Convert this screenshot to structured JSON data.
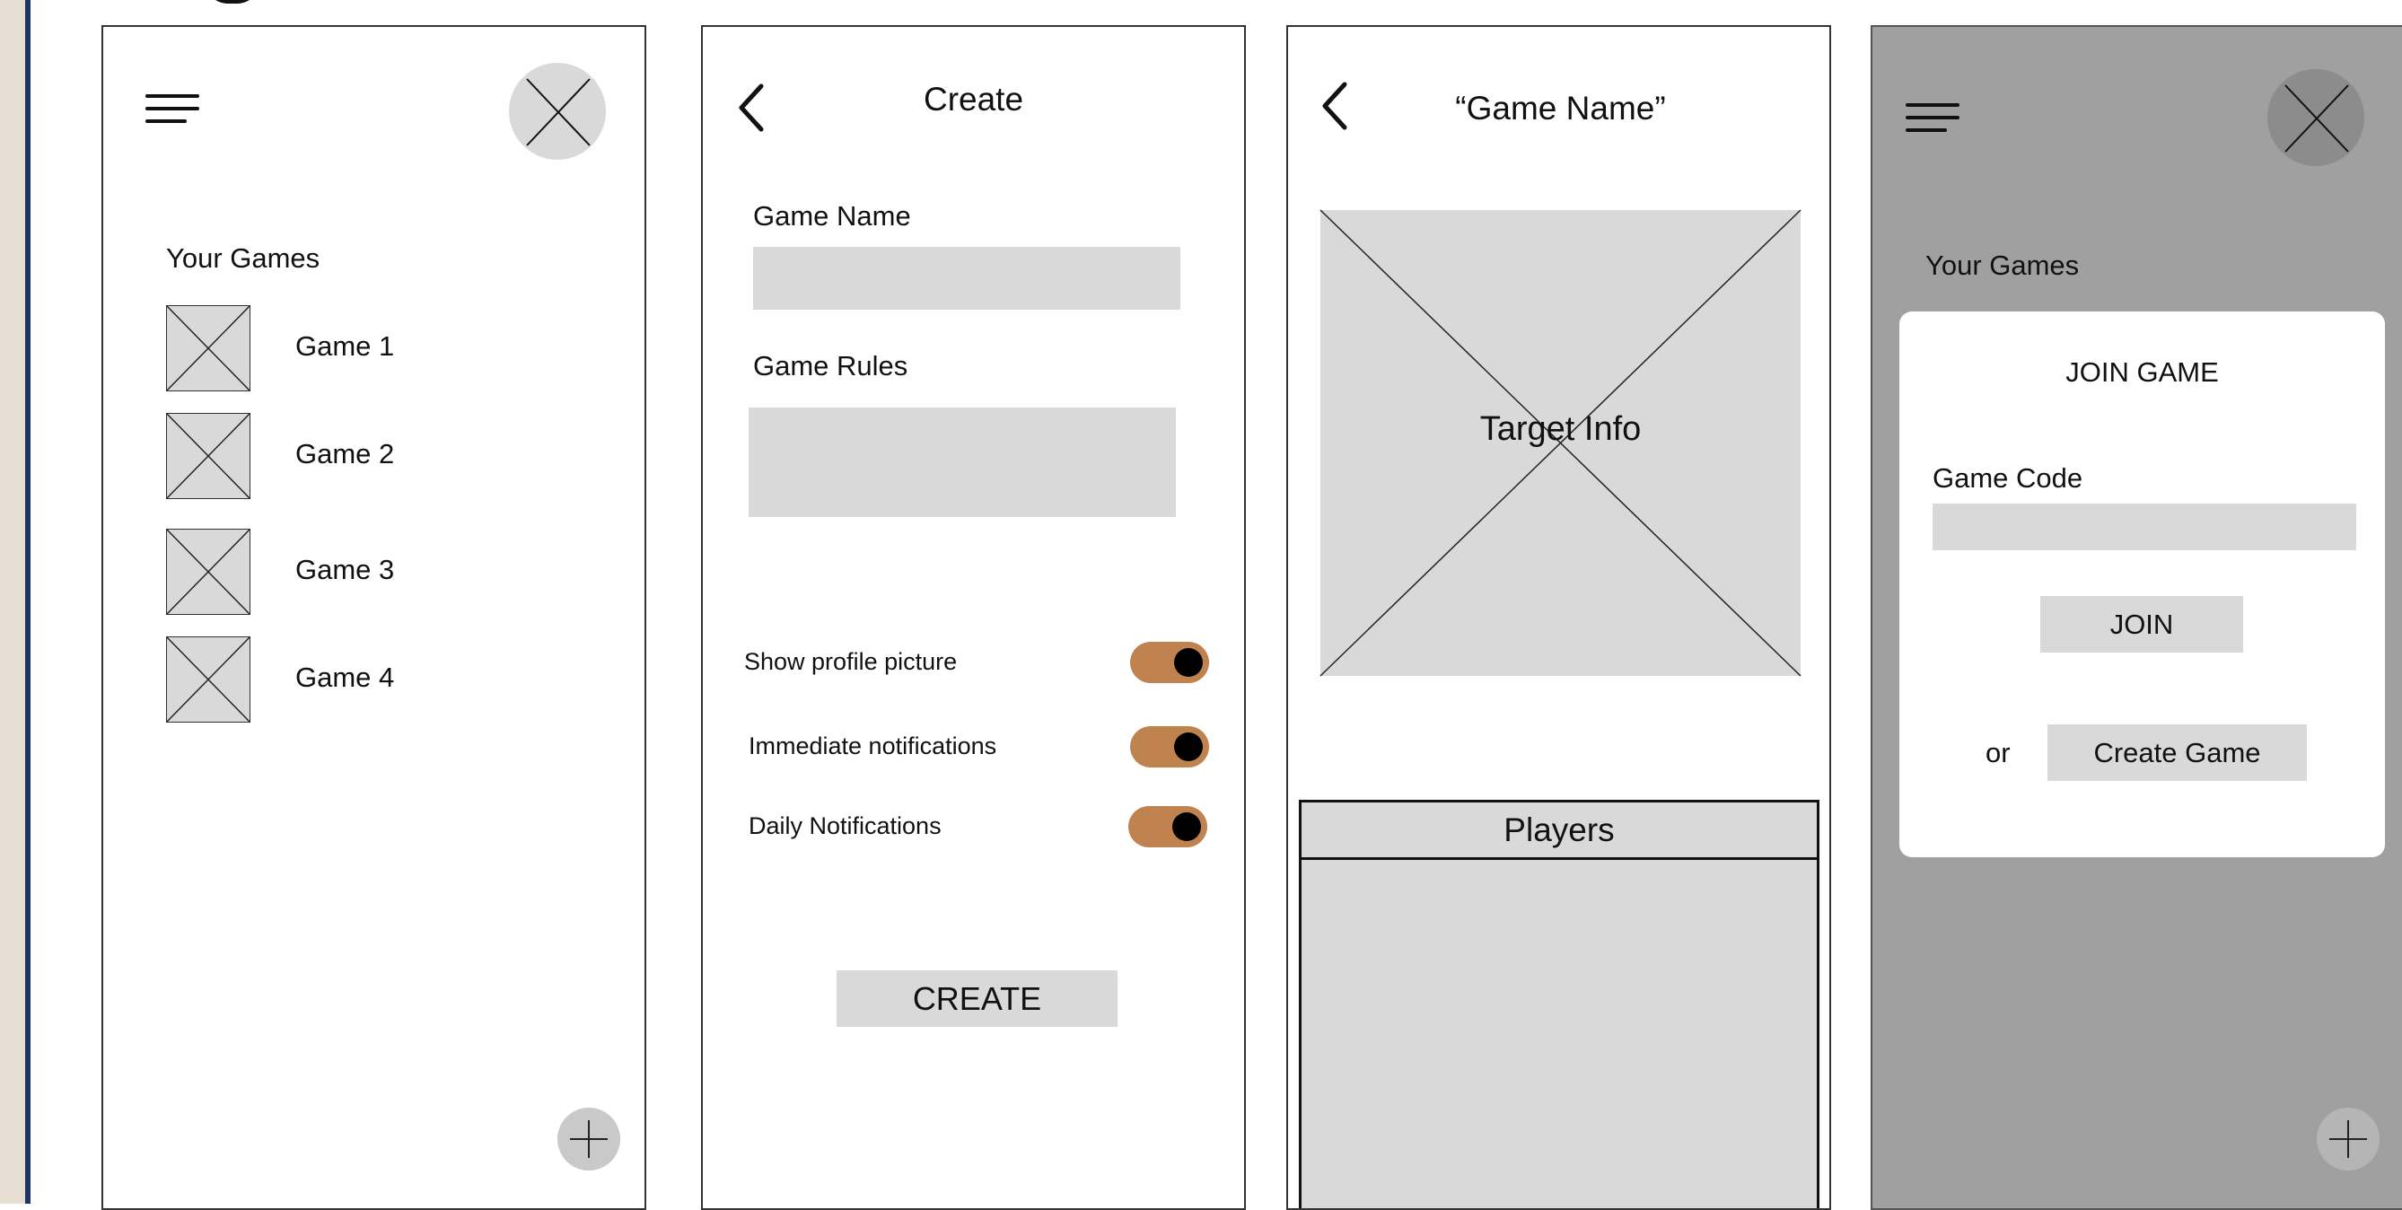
{
  "screen_home": {
    "section_title": "Your Games",
    "games": [
      "Game 1",
      "Game 2",
      "Game 3",
      "Game 4"
    ]
  },
  "screen_create": {
    "title": "Create",
    "game_name_label": "Game Name",
    "game_rules_label": "Game Rules",
    "toggles": [
      {
        "label": "Show profile picture",
        "on": true
      },
      {
        "label": "Immediate notifications",
        "on": true
      },
      {
        "label": "Daily Notifications",
        "on": true
      }
    ],
    "create_button": "CREATE"
  },
  "screen_game": {
    "title": "“Game Name”",
    "target_info": "Target Info",
    "players_header": "Players"
  },
  "screen_join": {
    "section_title": "Your Games",
    "modal_title": "JOIN GAME",
    "game_code_label": "Game Code",
    "join_button": "JOIN",
    "or_text": "or",
    "create_game_button": "Create Game"
  },
  "colors": {
    "placeholder": "#d9d9d9",
    "toggle_on": "#c0824e",
    "overlay": "#a0a0a0",
    "frame_accent": "#1e3366"
  },
  "icons": [
    "hamburger-menu-icon",
    "avatar-placeholder-icon",
    "back-chevron-icon",
    "add-plus-icon",
    "image-placeholder-icon"
  ]
}
